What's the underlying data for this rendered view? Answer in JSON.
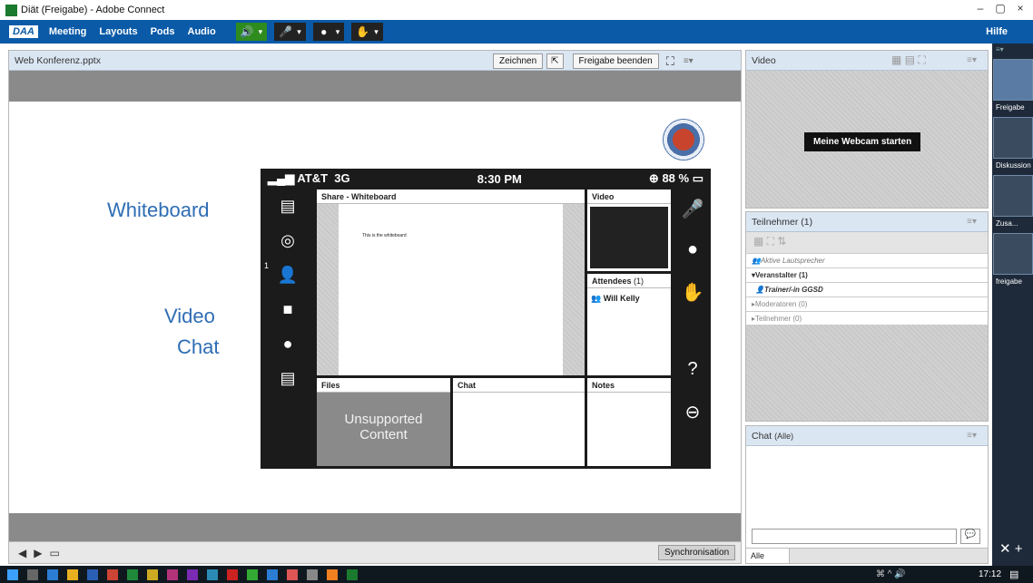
{
  "window": {
    "title": "Diät (Freigabe) - Adobe Connect",
    "controls": [
      "–",
      "▢",
      "×"
    ]
  },
  "menubar": {
    "logo": "DAA",
    "items": [
      "Meeting",
      "Layouts",
      "Pods",
      "Audio"
    ],
    "help": "Hilfe"
  },
  "share_pod": {
    "title": "Web Konferenz.pptx",
    "draw_button": "Zeichnen",
    "stop_share_button": "Freigabe beenden",
    "sync_button": "Synchronisation"
  },
  "slide": {
    "labels": [
      "Whiteboard",
      "Video",
      "Chat"
    ]
  },
  "phone": {
    "carrier": "AT&T",
    "network": "3G",
    "time": "8:30 PM",
    "battery": "88 %",
    "share_title": "Share - Whiteboard",
    "share_text": "This is the whiteboard",
    "video_title": "Video",
    "attendees_title": "Attendees",
    "attendees_count": "(1)",
    "attendee_name": "Will Kelly",
    "attendee_badge": "1",
    "files_title": "Files",
    "chat_title": "Chat",
    "notes_title": "Notes",
    "unsupported": "Unsupported Content"
  },
  "video_pod": {
    "title": "Video",
    "start_webcam": "Meine Webcam starten"
  },
  "participants_pod": {
    "title": "Teilnehmer",
    "count": "(1)",
    "active_speakers": "Aktive Lautsprecher",
    "host_group": "Veranstalter (1)",
    "host_name": "Trainer/-in GGSD",
    "moderators": "Moderatoren (0)",
    "participants": "Teilnehmer (0)"
  },
  "chat_pod": {
    "title": "Chat",
    "scope": "(Alle)",
    "tab": "Alle"
  },
  "layouts_rail": {
    "items": [
      "Freigabe",
      "Diskussion",
      "Zusa...",
      "freigabe"
    ]
  },
  "taskbar": {
    "time": "17:12"
  },
  "colors": {
    "menubar": "#0a5aa8",
    "header": "#dbe6f3",
    "slide_text": "#2e6db4"
  }
}
